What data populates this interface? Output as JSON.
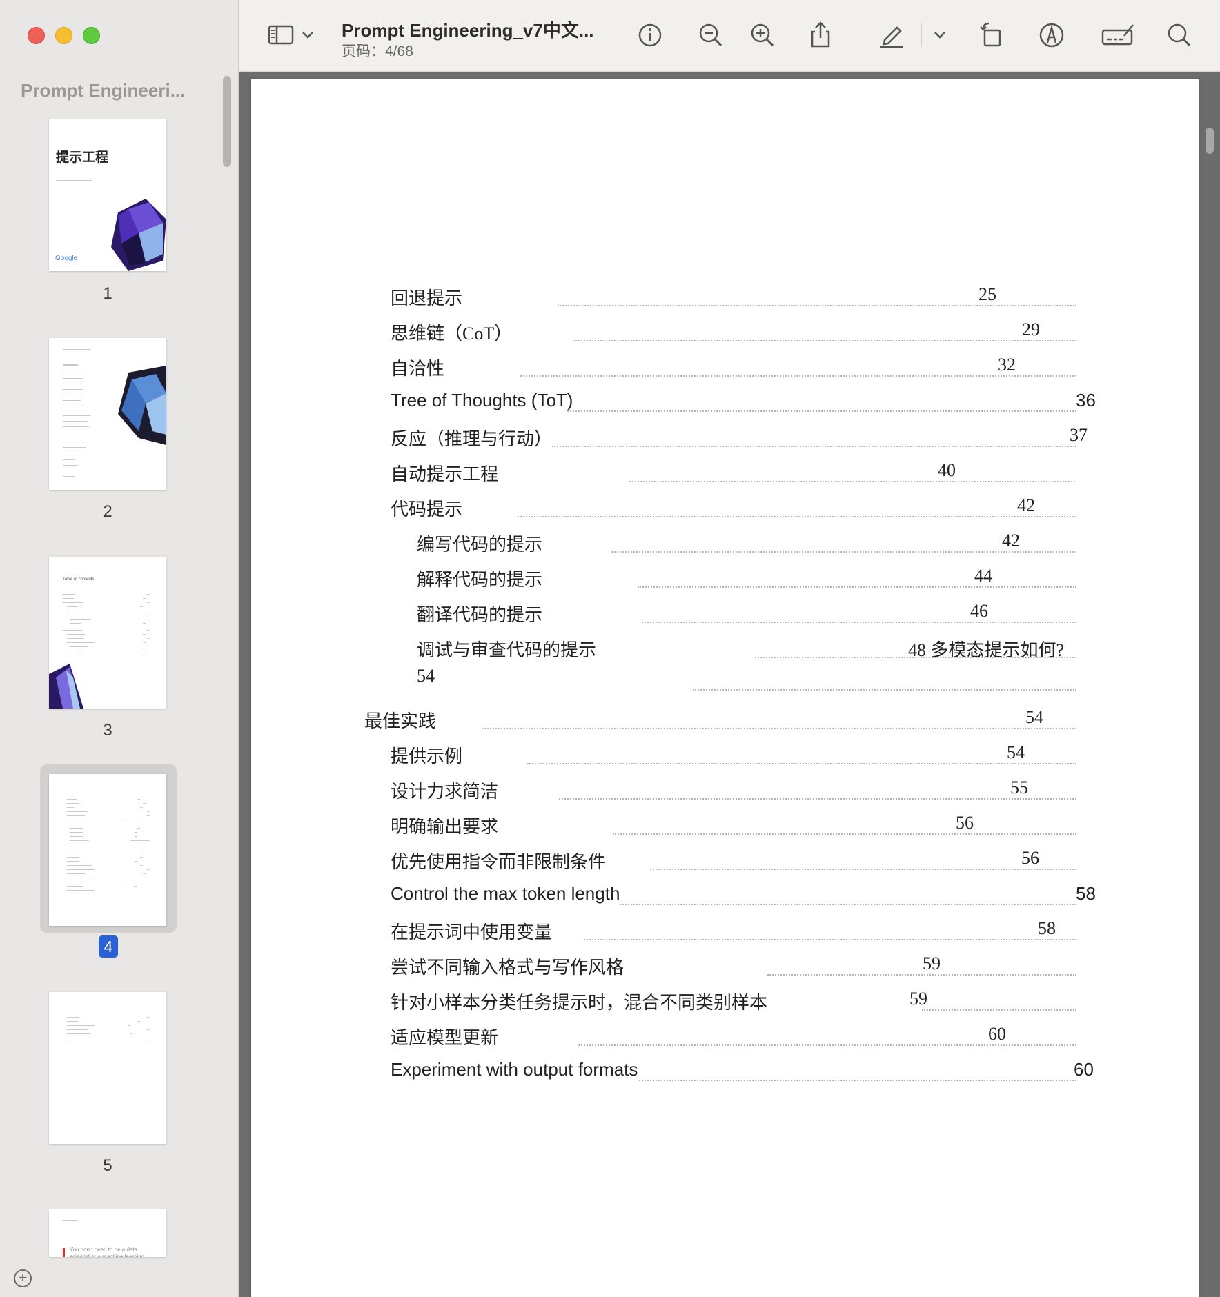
{
  "window": {
    "doc_title": "Prompt Engineering_v7中文...",
    "page_indicator": "页码：4/68"
  },
  "sidebar": {
    "title": "Prompt Engineeri...",
    "thumbnails": [
      {
        "number": "1",
        "heading": "提示工程"
      },
      {
        "number": "2",
        "heading": ""
      },
      {
        "number": "3",
        "heading": "Table of contents"
      },
      {
        "number": "4",
        "heading": ""
      },
      {
        "number": "5",
        "heading": ""
      },
      {
        "number": "",
        "heading": "You don t need to be a data scientist or a machine learning"
      }
    ],
    "thumb1_brand": "Google",
    "selected_page": "4"
  },
  "toolbar": {
    "icons": [
      "sidebar-toggle-icon",
      "chevron-down-icon",
      "info-icon",
      "zoom-out-icon",
      "zoom-in-icon",
      "share-icon",
      "highlight-pen-icon",
      "chevron-down-icon",
      "rotate-icon",
      "markup-icon",
      "signature-icon",
      "search-icon"
    ]
  },
  "toc": {
    "entries": [
      {
        "label": "回退提示",
        "page": "25"
      },
      {
        "label": "思维链（CoT）",
        "page": "29"
      },
      {
        "label": "自洽性",
        "page": "32"
      },
      {
        "label": "Tree of Thoughts (ToT)",
        "page": "36"
      },
      {
        "label": "反应（推理与行动）",
        "page": "37"
      },
      {
        "label": "自动提示工程",
        "page": "40"
      },
      {
        "label": "代码提示",
        "page": "42"
      },
      {
        "label": "编写代码的提示",
        "page": "42"
      },
      {
        "label": "解释代码的提示",
        "page": "44"
      },
      {
        "label": "翻译代码的提示",
        "page": "46"
      },
      {
        "label": "调试与审查代码的提示",
        "page": "48 多模态提示如何?"
      },
      {
        "label": "54",
        "page": ""
      },
      {
        "label": "最佳实践",
        "page": "54"
      },
      {
        "label": "提供示例",
        "page": "54"
      },
      {
        "label": "设计力求简洁",
        "page": "55"
      },
      {
        "label": "明确输出要求",
        "page": "56"
      },
      {
        "label": "优先使用指令而非限制条件",
        "page": "56"
      },
      {
        "label": "Control the max token length",
        "page": "58"
      },
      {
        "label": "在提示词中使用变量",
        "page": "58"
      },
      {
        "label": "尝试不同输入格式与写作风格",
        "page": "59"
      },
      {
        "label": "针对小样本分类任务提示时，混合不同类别样本",
        "page": "59"
      },
      {
        "label": "适应模型更新",
        "page": "60"
      },
      {
        "label": "Experiment with output formats",
        "page": "60"
      }
    ]
  }
}
